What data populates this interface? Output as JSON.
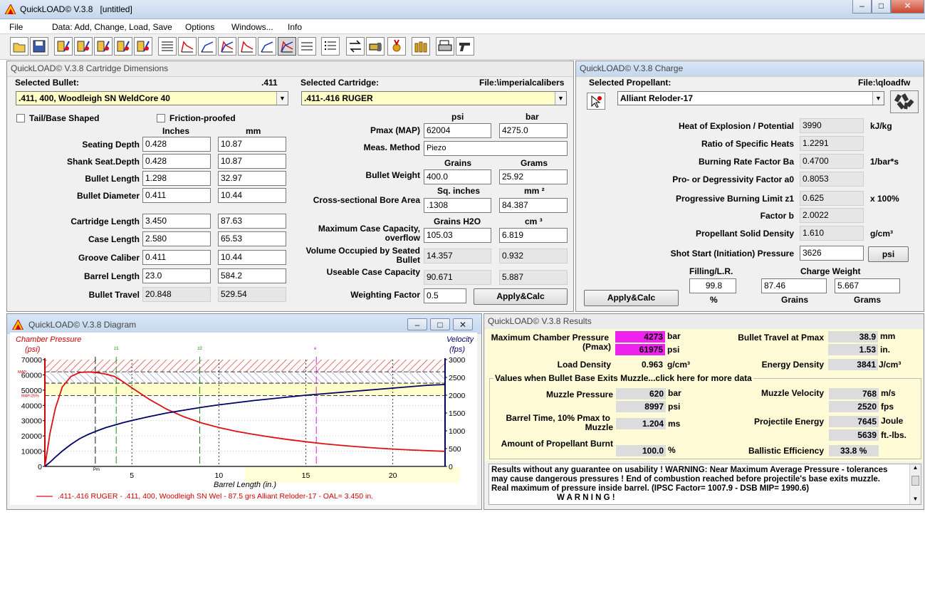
{
  "app": {
    "title": "QuickLOAD© V.3.8   [untitled]"
  },
  "window_controls": {
    "minimize": "‒",
    "maximize": "□",
    "close": "✕"
  },
  "menu": [
    "File",
    "Data: Add, Change, Load, Save",
    "Options",
    "Windows...",
    "Info"
  ],
  "toolbar_icons": [
    "open-file-icon",
    "save-file-icon",
    "bullet-database-icon",
    "cartridge-database-icon",
    "propellant-database-icon",
    "edit-bullet-icon",
    "edit-powder-icon",
    "table-view-icon",
    "pressure-chart-icon",
    "velocity-chart-icon",
    "combined-chart-icon",
    "pressure-time-icon",
    "velocity-time-icon",
    "diagram-icon",
    "ladder-table-icon",
    "list-table-icon",
    "compare-icon",
    "case-icon",
    "medal-icon",
    "cartridges-icon",
    "printer-icon",
    "pistol-icon"
  ],
  "dims": {
    "title": "QuickLOAD© V.3.8 Cartridge Dimensions",
    "selected_bullet_label": "Selected Bullet:",
    "bullet_caliber": ".411",
    "selected_cartridge_label": "Selected Cartridge:",
    "cartridge_file": "File:\\imperialcalibers",
    "bullet": ".411, 400, Woodleigh SN WeldCore 40",
    "cartridge": ".411-.416 RUGER",
    "tail_label": "Tail/Base Shaped",
    "friction_label": "Friction-proofed",
    "col_inches": "Inches",
    "col_mm": "mm",
    "left_rows": [
      {
        "label": "Seating Depth",
        "in": "0.428",
        "mm": "10.87",
        "ro": false
      },
      {
        "label": "Shank Seat.Depth",
        "in": "0.428",
        "mm": "10.87",
        "ro": false
      },
      {
        "label": "Bullet Length",
        "in": "1.298",
        "mm": "32.97",
        "ro": false
      },
      {
        "label": "Bullet Diameter",
        "in": "0.411",
        "mm": "10.44",
        "ro": false
      },
      {
        "label": "Cartridge Length",
        "in": "3.450",
        "mm": "87.63",
        "ro": false
      },
      {
        "label": "Case Length",
        "in": "2.580",
        "mm": "65.53",
        "ro": false
      },
      {
        "label": "Groove Caliber",
        "in": "0.411",
        "mm": "10.44",
        "ro": false
      },
      {
        "label": "Barrel Length",
        "in": "23.0",
        "mm": "584.2",
        "ro": false
      },
      {
        "label": "Bullet Travel",
        "in": "20.848",
        "mm": "529.54",
        "ro": true
      }
    ],
    "psi_head": "psi",
    "bar_head": "bar",
    "pmax_label": "Pmax (MAP)",
    "pmax_psi": "62004",
    "pmax_bar": "4275.0",
    "meas_label": "Meas. Method",
    "meas_value": "Piezo",
    "grains_head": "Grains",
    "grams_head": "Grams",
    "bw_label": "Bullet Weight",
    "bw_grains": "400.0",
    "bw_grams": "25.92",
    "sqin_head": "Sq. inches",
    "mm2_head": "mm ²",
    "bore_label": "Cross-sectional Bore Area",
    "bore_sqin": ".1308",
    "bore_mm2": "84.387",
    "h2o_head": "Grains H2O",
    "cm3_head": "cm ³",
    "cap_label1": "Maximum Case Capacity,",
    "cap_label2": "overflow",
    "cap_grains": "105.03",
    "cap_cm3": "6.819",
    "vol_label1": "Volume Occupied by Seated",
    "vol_label2": "Bullet",
    "vol_grains": "14.357",
    "vol_cm3": "0.932",
    "use_label": "Useable Case Capacity",
    "use_grains": "90.671",
    "use_cm3": "5.887",
    "wf_label": "Weighting Factor",
    "wf_value": "0.5",
    "apply": "Apply&Calc"
  },
  "charge": {
    "title": "QuickLOAD© V.3.8 Charge",
    "sel_label": "Selected Propellant:",
    "file": "File:\\qloadfw",
    "propellant": "Alliant Reloder-17",
    "rows": [
      {
        "label": "Heat of Explosion / Potential",
        "value": "3990",
        "unit": "kJ/kg"
      },
      {
        "label": "Ratio of Specific Heats",
        "value": "1.2291",
        "unit": ""
      },
      {
        "label": "Burning Rate Factor  Ba",
        "value": "0.4700",
        "unit": "1/bar*s"
      },
      {
        "label": "Pro- or Degressivity Factor  a0",
        "value": "0.8053",
        "unit": ""
      },
      {
        "label": "Progressive Burning Limit z1",
        "value": "0.625",
        "unit": "x 100%"
      },
      {
        "label": "Factor  b",
        "value": "2.0022",
        "unit": ""
      },
      {
        "label": "Propellant Solid Density",
        "value": "1.610",
        "unit": "g/cm³"
      }
    ],
    "shot_label": "Shot Start (Initiation) Pressure",
    "shot_value": "3626",
    "shot_unit": "psi",
    "fill_label": "Filling/L.R.",
    "fill_value": "99.8",
    "fill_unit": "%",
    "cw_label": "Charge Weight",
    "cw_grains": "87.46",
    "cw_grams": "5.667",
    "grains_unit": "Grains",
    "grams_unit": "Grams",
    "apply": "Apply&Calc"
  },
  "diagram": {
    "title": "QuickLOAD© V.3.8 Diagram",
    "left_title": "Chamber Pressure",
    "left_unit": "(psi)",
    "right_title": "Velocity",
    "right_unit": "(fps)",
    "xlabel": "Barrel Length (in.)",
    "map_label": "MAP",
    "map25_label": "MAP-25%",
    "marker_labels": [
      "Pm",
      "z1",
      "z2",
      "e"
    ],
    "legend": ".411-.416 RUGER - .411, 400, Woodleigh SN Wel - 87.5 grs Alliant Reloder-17 - OAL= 3.450 in.",
    "pressure_color": "#dd1111",
    "velocity_color": "#000066",
    "y_left_ticks": [
      "70000",
      "60000",
      "50000",
      "40000",
      "30000",
      "20000",
      "10000",
      "0"
    ],
    "y_right_ticks": [
      "3000",
      "2500",
      "2000",
      "1500",
      "1000",
      "500",
      "0"
    ],
    "x_ticks": [
      "5",
      "10",
      "15",
      "20"
    ]
  },
  "chart_data": {
    "type": "line",
    "title": "",
    "xlabel": "Barrel Length (in.)",
    "ylabel": "Chamber Pressure (psi)",
    "y2label": "Velocity (fps)",
    "xlim": [
      0,
      23
    ],
    "ylim": [
      0,
      70000
    ],
    "y2lim": [
      0,
      3000
    ],
    "grid": true,
    "x": [
      0,
      0.3,
      0.6,
      1,
      1.5,
      2,
      2.5,
      3,
      3.5,
      4,
      4.5,
      5,
      6,
      7,
      8,
      9,
      10,
      11,
      12,
      13,
      14,
      15,
      16,
      17,
      18,
      19,
      20,
      21,
      22,
      23
    ],
    "series": [
      {
        "name": "",
        "axis": "left",
        "values": [
          0,
          22000,
          38000,
          52000,
          59000,
          61600,
          61950,
          61500,
          60500,
          59000,
          55500,
          51500,
          44000,
          37500,
          32500,
          28500,
          25500,
          23000,
          21000,
          19200,
          17600,
          16200,
          14900,
          13800,
          12900,
          12100,
          11400,
          10800,
          10300,
          9900
        ]
      },
      {
        "name": "",
        "axis": "right",
        "values": [
          0,
          120,
          260,
          430,
          620,
          780,
          900,
          1000,
          1090,
          1160,
          1230,
          1290,
          1400,
          1500,
          1580,
          1660,
          1730,
          1790,
          1850,
          1900,
          1950,
          2000,
          2040,
          2080,
          2120,
          2160,
          2200,
          2240,
          2280,
          2300
        ]
      }
    ],
    "markers": {
      "Pm": 2.9,
      "z1": 4.1,
      "z2": 8.9,
      "e": 15.6
    },
    "bands": {
      "map_psi": 62004
    }
  },
  "results": {
    "title": "QuickLOAD© V.3.8 Results",
    "mcp_label": "Maximum Chamber Pressure",
    "pmax_label": "(Pmax)",
    "mcp_bar": "4273",
    "bar": "bar",
    "mcp_psi": "61975",
    "psi": "psi",
    "bt_label": "Bullet Travel at Pmax",
    "bt_mm": "38.9",
    "mm": "mm",
    "bt_in": "1.53",
    "in": "in.",
    "ld_label": "Load Density",
    "ld": "0.963",
    "gcm": "g/cm³",
    "ed_label": "Energy Density",
    "ed": "3841",
    "jcm": "J/cm³",
    "muzzle_header": "Values when Bullet Base Exits Muzzle...click here for more data",
    "mp_label": "Muzzle Pressure",
    "mp_bar": "620",
    "mp_psi": "8997",
    "mv_label": "Muzzle Velocity",
    "mv_ms": "768",
    "ms": "m/s",
    "mv_fps": "2520",
    "fps": "fps",
    "bt10_label1": "Barrel Time, 10% Pmax to",
    "bt10_label2": "Muzzle",
    "bt10": "1.204",
    "msu": "ms",
    "pe_label": "Projectile Energy",
    "pe_j": "7645",
    "joule": "Joule",
    "pe_ftlb": "5639",
    "ftlbs": "ft.-lbs.",
    "burnt_label": "Amount of Propellant Burnt",
    "burnt": "100.0",
    "pct": "%",
    "be_label": "Ballistic Efficiency",
    "be": "33.8",
    "warnings": [
      "Results without any guarantee on usability !  WARNING: Near Maximum Average Pressure - tolerances",
      "may cause dangerous pressures !  End of combustion reached before projectile's base exits muzzle.",
      "Real maximum of pressure inside barrel.  (IPSC Factor= 1007.9 - DSB MIP= 1990.6)",
      "W A R N I N G !"
    ]
  }
}
